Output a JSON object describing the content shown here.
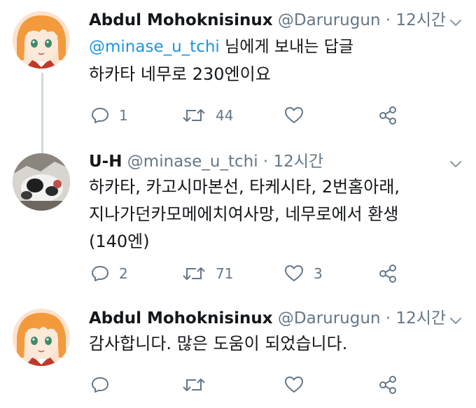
{
  "tweets": [
    {
      "name": "Abdul Mohoknisinux",
      "handle": "@Darurugun",
      "dot": "·",
      "time": "12시간",
      "reply_mention": "@minase_u_tchi",
      "reply_rest": " 님에게 보내는 답글",
      "lines": [
        "하카타 네무로 230엔이요"
      ],
      "replies": "1",
      "retweets": "44",
      "likes": ""
    },
    {
      "name": "U-H",
      "handle": "@minase_u_tchi",
      "dot": "·",
      "time": "12시간",
      "lines": [
        "하카타, 카고시마본선, 타케시타, 2번홈아래,",
        "지나가던카모메에치여사망, 네무로에서 환생",
        "(140엔)"
      ],
      "replies": "2",
      "retweets": "71",
      "likes": "3"
    },
    {
      "name": "Abdul Mohoknisinux",
      "handle": "@Darurugun",
      "dot": "·",
      "time": "12시간",
      "lines": [
        "감사합니다. 많은 도움이 되었습니다."
      ],
      "replies": "",
      "retweets": "",
      "likes": ""
    }
  ],
  "icons": {
    "reply": "reply-icon",
    "retweet": "retweet-icon",
    "like": "heart-icon",
    "share": "share-icon",
    "caret": "chevron-down-icon"
  },
  "colors": {
    "name": "#14171a",
    "meta": "#657786",
    "mention": "#1b95e0",
    "thread_line": "#cfd9de"
  }
}
